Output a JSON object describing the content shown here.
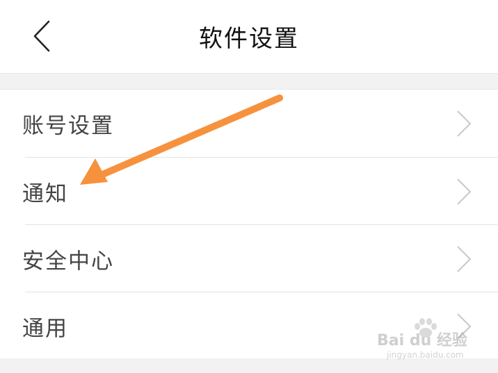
{
  "header": {
    "title": "软件设置",
    "back_icon": "chevron-left-icon"
  },
  "settings": {
    "items": [
      {
        "label": "账号设置",
        "icon": "chevron-right-icon"
      },
      {
        "label": "通知",
        "icon": "chevron-right-icon"
      },
      {
        "label": "安全中心",
        "icon": "chevron-right-icon"
      },
      {
        "label": "通用",
        "icon": "chevron-right-icon"
      }
    ]
  },
  "annotation": {
    "type": "arrow",
    "color": "#f6923e",
    "points_to": "通知"
  },
  "watermark": {
    "main": "Bai du 经验",
    "sub": "jingyan.baidu.com"
  },
  "colors": {
    "background": "#ffffff",
    "separator_band": "#f2f2f2",
    "label_text": "#444444",
    "title_text": "#111111",
    "chevron": "#c8c8c8"
  }
}
